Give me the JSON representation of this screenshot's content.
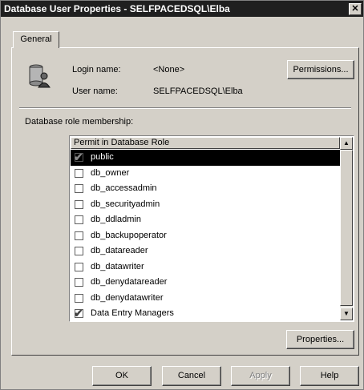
{
  "window": {
    "title": "Database User Properties - SELFPACEDSQL\\Elba",
    "close_glyph": "✕"
  },
  "tabs": [
    {
      "label": "General"
    }
  ],
  "login": {
    "label": "Login name:",
    "value": "<None>"
  },
  "user": {
    "label": "User name:",
    "value": "SELFPACEDSQL\\Elba"
  },
  "permissions_button": "Permissions...",
  "role_section_label": "Database role membership:",
  "role_list": {
    "column_header": "Permit in Database Role",
    "items": [
      {
        "label": "public",
        "checked": true,
        "selected": true
      },
      {
        "label": "db_owner",
        "checked": false,
        "selected": false
      },
      {
        "label": "db_accessadmin",
        "checked": false,
        "selected": false
      },
      {
        "label": "db_securityadmin",
        "checked": false,
        "selected": false
      },
      {
        "label": "db_ddladmin",
        "checked": false,
        "selected": false
      },
      {
        "label": "db_backupoperator",
        "checked": false,
        "selected": false
      },
      {
        "label": "db_datareader",
        "checked": false,
        "selected": false
      },
      {
        "label": "db_datawriter",
        "checked": false,
        "selected": false
      },
      {
        "label": "db_denydatareader",
        "checked": false,
        "selected": false
      },
      {
        "label": "db_denydatawriter",
        "checked": false,
        "selected": false
      },
      {
        "label": "Data Entry Managers",
        "checked": true,
        "selected": false
      }
    ]
  },
  "properties_button": "Properties...",
  "footer": {
    "ok": "OK",
    "cancel": "Cancel",
    "apply": "Apply",
    "help": "Help"
  },
  "icons": {
    "database_user": "database-user-icon",
    "close": "close-icon",
    "scroll_up": "scroll-up-arrow-icon",
    "scroll_down": "scroll-down-arrow-icon",
    "checkmark": "checkmark-icon"
  }
}
